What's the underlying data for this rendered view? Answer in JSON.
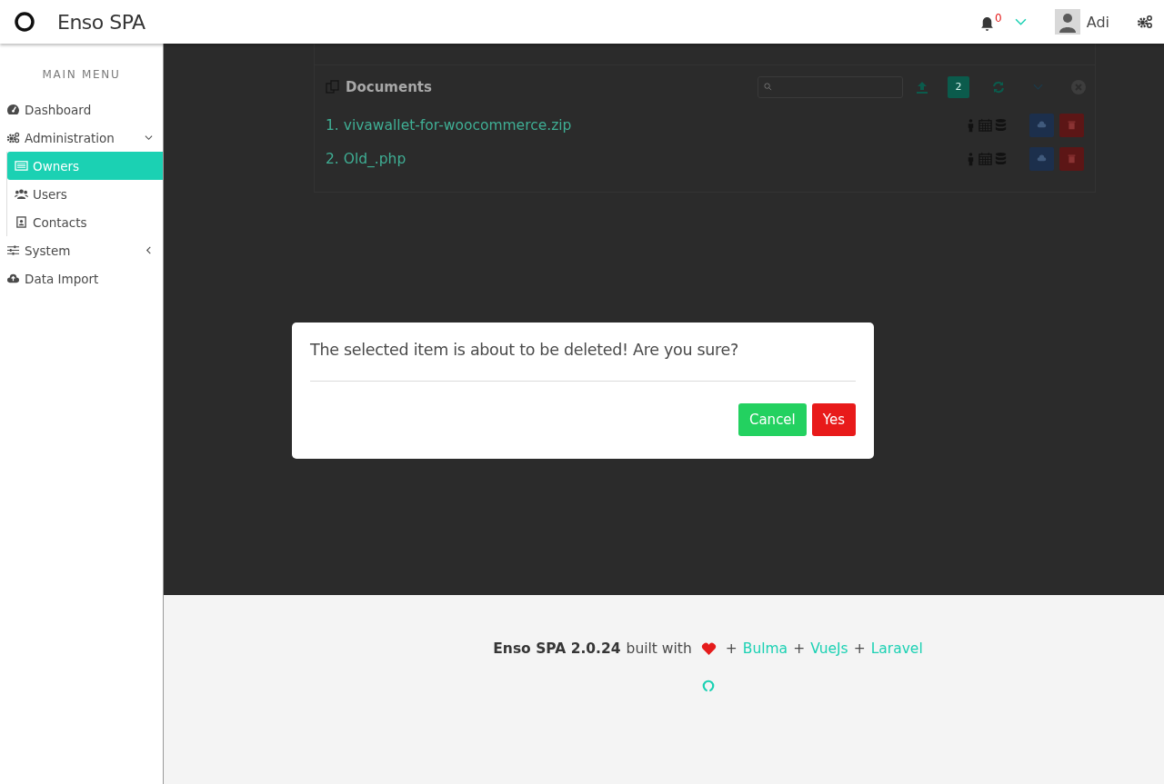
{
  "navbar": {
    "brand": "Enso SPA",
    "notification_count": "0",
    "user": "Adi"
  },
  "sidebar": {
    "heading": "MAIN MENU",
    "items": [
      {
        "label": "Dashboard",
        "selected": false
      },
      {
        "label": "Administration",
        "selected": false,
        "expanded": true,
        "children": [
          {
            "label": "Owners",
            "selected": true
          },
          {
            "label": "Users",
            "selected": false
          },
          {
            "label": "Contacts",
            "selected": false
          }
        ]
      },
      {
        "label": "System",
        "selected": false,
        "expanded": false
      },
      {
        "label": "Data Import",
        "selected": false
      }
    ]
  },
  "documents": {
    "title": "Documents",
    "count": "2",
    "files": [
      "1. vivawallet-for-woocommerce.zip",
      "2. Old_.php"
    ]
  },
  "dialog": {
    "message": "The selected item is about to be deleted! Are you sure?",
    "buttons": [
      {
        "kind": "cancel",
        "label": "Cancel"
      },
      {
        "kind": "confirm",
        "label": "Yes"
      }
    ]
  },
  "footer": {
    "items": [
      {
        "kind": "bold",
        "text": "Enso SPA 2.0.24"
      },
      {
        "kind": "text",
        "text": "built with"
      },
      {
        "kind": "heart"
      },
      {
        "kind": "text",
        "text": "+"
      },
      {
        "kind": "link",
        "text": "Bulma"
      },
      {
        "kind": "text",
        "text": "+"
      },
      {
        "kind": "link",
        "text": "VueJs"
      },
      {
        "kind": "text",
        "text": "+"
      },
      {
        "kind": "link",
        "text": "Laravel"
      }
    ]
  }
}
